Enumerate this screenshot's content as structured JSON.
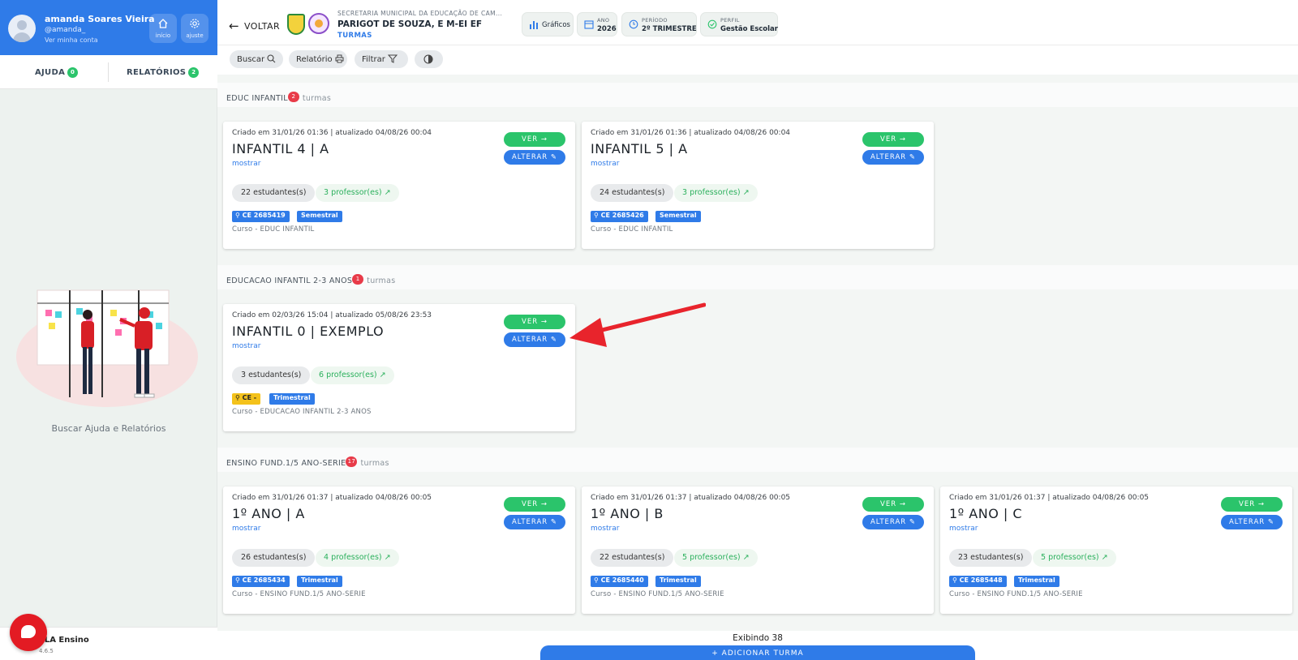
{
  "user": {
    "name": "amanda Soares Vieira",
    "handle": "@amanda_",
    "link": "Ver minha conta",
    "home_label": "início",
    "settings_label": "ajuste"
  },
  "side_tabs": {
    "help_label": "AJUDA",
    "help_count": "0",
    "reports_label": "RELATÓRIOS",
    "reports_count": "2"
  },
  "sidebar": {
    "help_text": "Buscar Ajuda e Relatórios",
    "brand_name": "TLA Ensino",
    "brand_version": "4.6.5"
  },
  "header": {
    "back_label": "VOLTAR",
    "school_top": "SECRETARIA MUNICIPAL DA EDUCAÇÃO DE CAM...",
    "school_name": "PARIGOT DE SOUZA, E M-EI EF",
    "school_sub": "TURMAS",
    "charts_label": "Gráficos",
    "year_key": "ANO",
    "year_value": "2026",
    "period_key": "PERÍODO",
    "period_value": "2º TRIMESTRE",
    "profile_key": "PERFIL",
    "profile_value": "Gestão Escolar"
  },
  "toolbar": {
    "search_label": "Buscar",
    "report_label": "Relatório",
    "filter_label": "Filtrar"
  },
  "groups": [
    {
      "title": "EDUC INFANTIL",
      "count": "2",
      "suffix": "turmas",
      "cards": [
        {
          "created": "Criado em 31/01/26 01:36 | atualizado 04/08/26 00:04",
          "title": "INFANTIL 4 | A",
          "show": "mostrar",
          "ver": "VER",
          "alterar": "ALTERAR",
          "students": "22 estudantes(s)",
          "teachers": "3 professor(es)",
          "ce": "CE 2685419",
          "period": "Semestral",
          "course": "Curso - EDUC INFANTIL"
        },
        {
          "created": "Criado em 31/01/26 01:36 | atualizado 04/08/26 00:04",
          "title": "INFANTIL 5 | A",
          "show": "mostrar",
          "ver": "VER",
          "alterar": "ALTERAR",
          "students": "24 estudantes(s)",
          "teachers": "3 professor(es)",
          "ce": "CE 2685426",
          "period": "Semestral",
          "course": "Curso - EDUC INFANTIL"
        }
      ]
    },
    {
      "title": "EDUCACAO INFANTIL 2-3 ANOS",
      "count": "1",
      "suffix": "turmas",
      "cards": [
        {
          "created": "Criado em 02/03/26 15:04 | atualizado 05/08/26 23:53",
          "title": "INFANTIL 0 | EXEMPLO",
          "show": "mostrar",
          "ver": "VER",
          "alterar": "ALTERAR",
          "students": "3 estudantes(s)",
          "teachers": "6 professor(es)",
          "ce": "CE -",
          "period": "Trimestral",
          "course": "Curso - EDUCACAO INFANTIL 2-3 ANOS"
        }
      ]
    },
    {
      "title": "ENSINO FUND.1/5 ANO-SERIE",
      "count": "17",
      "suffix": "turmas",
      "cards": [
        {
          "created": "Criado em 31/01/26 01:37 | atualizado 04/08/26 00:05",
          "title": "1º ANO | A",
          "show": "mostrar",
          "ver": "VER",
          "alterar": "ALTERAR",
          "students": "26 estudantes(s)",
          "teachers": "4 professor(es)",
          "ce": "CE 2685434",
          "period": "Trimestral",
          "course": "Curso - ENSINO FUND.1/5 ANO-SERIE"
        },
        {
          "created": "Criado em 31/01/26 01:37 | atualizado 04/08/26 00:05",
          "title": "1º ANO | B",
          "show": "mostrar",
          "ver": "VER",
          "alterar": "ALTERAR",
          "students": "22 estudantes(s)",
          "teachers": "5 professor(es)",
          "ce": "CE 2685440",
          "period": "Trimestral",
          "course": "Curso - ENSINO FUND.1/5 ANO-SERIE"
        },
        {
          "created": "Criado em 31/01/26 01:37 | atualizado 04/08/26 00:05",
          "title": "1º ANO | C",
          "show": "mostrar",
          "ver": "VER",
          "alterar": "ALTERAR",
          "students": "23 estudantes(s)",
          "teachers": "5 professor(es)",
          "ce": "CE 2685448",
          "period": "Trimestral",
          "course": "Curso - ENSINO FUND.1/5 ANO-SERIE"
        }
      ]
    }
  ],
  "footer": {
    "showing": "Exibindo 38",
    "add_label": "+ ADICIONAR TURMA"
  },
  "colors": {
    "primary": "#2f7be8",
    "success": "#2bc46b",
    "danger": "#e83b49",
    "warning": "#f4c21b",
    "annotation_arrow": "#e8242c"
  }
}
